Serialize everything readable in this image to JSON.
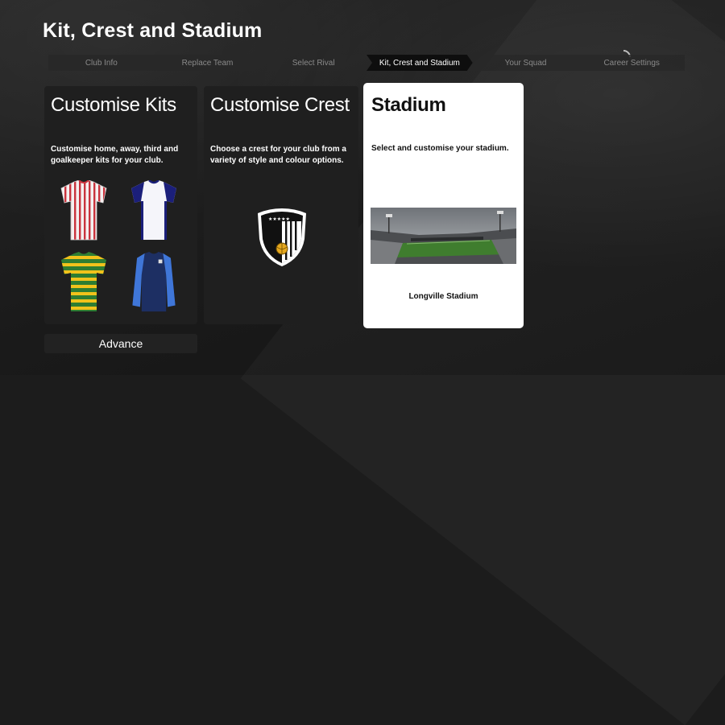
{
  "page": {
    "title": "Kit, Crest and Stadium"
  },
  "steps": [
    {
      "label": "Club Info"
    },
    {
      "label": "Replace Team"
    },
    {
      "label": "Select Rival"
    },
    {
      "label": "Kit, Crest and Stadium"
    },
    {
      "label": "Your Squad"
    },
    {
      "label": "Career Settings"
    }
  ],
  "active_step": "Kit, Crest and Stadium",
  "cards": {
    "kits": {
      "title": "Customise Kits",
      "description": "Customise home, away, third and goalkeeper kits for your club."
    },
    "crest": {
      "title": "Customise Crest",
      "description": "Choose a crest for your club from a variety of style and colour options."
    },
    "stadium": {
      "title": "Stadium",
      "description": "Select and customise your stadium.",
      "name": "Longville Stadium"
    }
  },
  "advance": {
    "label": "Advance"
  },
  "icons": {
    "kits": [
      "home-kit-icon",
      "away-kit-icon",
      "third-kit-icon",
      "goalkeeper-kit-icon"
    ],
    "crest": "shield-crest-icon"
  },
  "colors": {
    "selected_card": "#ffffff",
    "card_bg": "#1f1f1f",
    "active_step_bg": "#0e0e0e"
  }
}
